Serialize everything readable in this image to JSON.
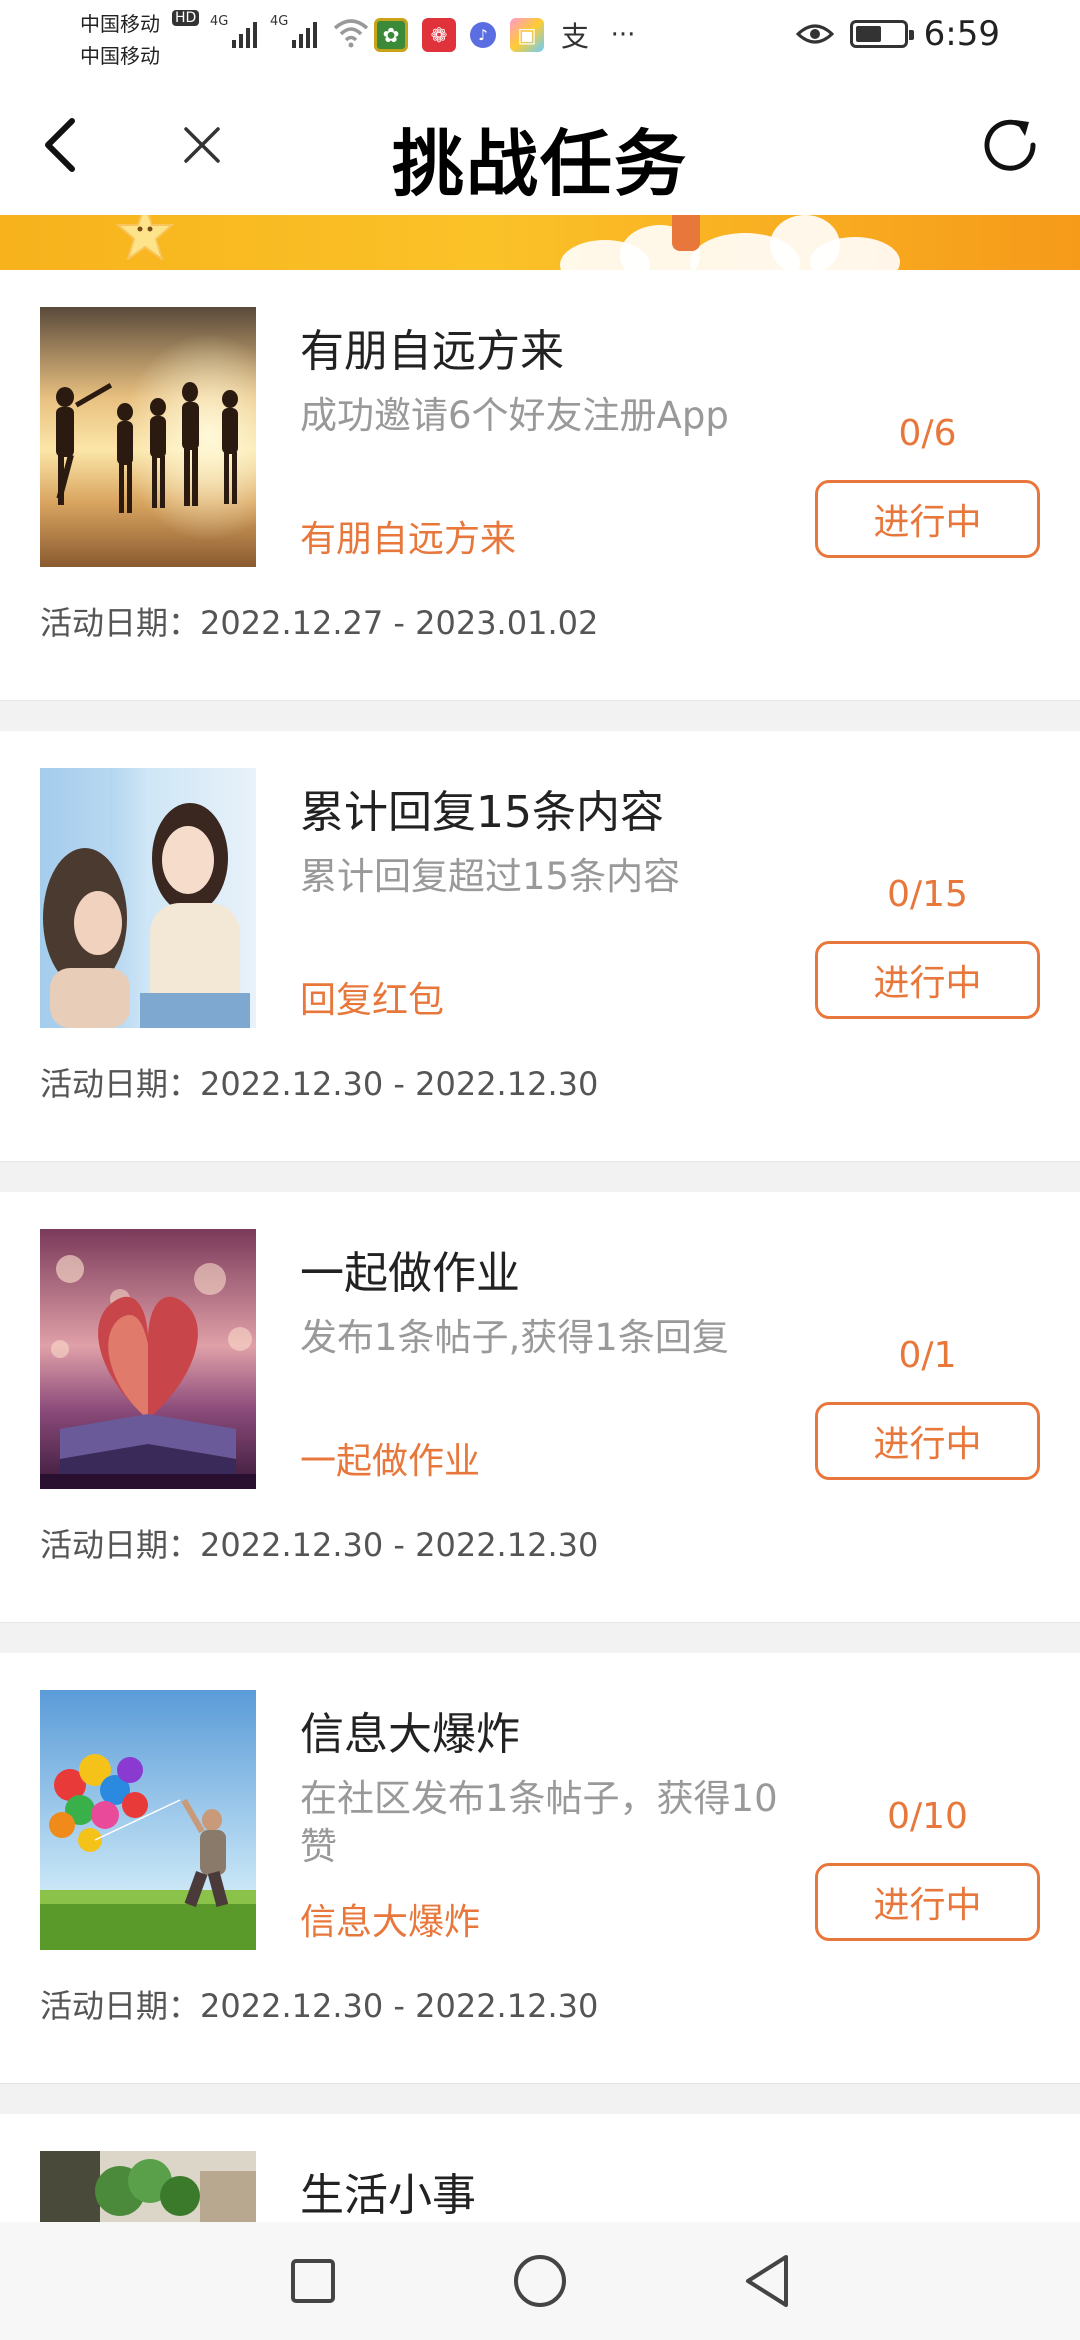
{
  "status_bar": {
    "carrier_1": "中国移动",
    "carrier_2": "中国移动",
    "hd": "HD",
    "network_1": "4G",
    "network_2": "4G",
    "battery_level": 0.55,
    "time": "6:59",
    "app_icons": [
      "app-badge-icon",
      "pinduoduo-icon",
      "music-icon",
      "gallery-icon",
      "alipay-icon"
    ],
    "more": "···"
  },
  "header": {
    "title": "挑战任务",
    "back_icon": "chevron-left-icon",
    "close_icon": "close-icon",
    "refresh_icon": "refresh-icon"
  },
  "tasks": [
    {
      "title": "有朋自远方来",
      "description": "成功邀请6个好友注册App",
      "tag": "有朋自远方来",
      "progress": "0/6",
      "status": "进行中",
      "date": "活动日期：2022.12.27 - 2023.01.02",
      "thumb": "beach-friends-image"
    },
    {
      "title": "累计回复15条内容",
      "description": "累计回复超过15条内容",
      "tag": "回复红包",
      "progress": "0/15",
      "status": "进行中",
      "date": "活动日期：2022.12.30 - 2022.12.30",
      "thumb": "two-girls-image"
    },
    {
      "title": "一起做作业",
      "description": "发布1条帖子,获得1条回复",
      "tag": "一起做作业",
      "progress": "0/1",
      "status": "进行中",
      "date": "活动日期：2022.12.30 - 2022.12.30",
      "thumb": "heart-book-image"
    },
    {
      "title": "信息大爆炸",
      "description": "在社区发布1条帖子，获得10赞",
      "tag": "信息大爆炸",
      "progress": "0/10",
      "status": "进行中",
      "date": "活动日期：2022.12.30 - 2022.12.30",
      "thumb": "balloons-image"
    },
    {
      "title": "生活小事",
      "thumb": "plants-image"
    }
  ],
  "nav": {
    "recent_icon": "square-icon",
    "home_icon": "circle-icon",
    "back_icon": "triangle-back-icon"
  },
  "colors": {
    "accent": "#e8773c",
    "banner_start": "#f7b21c",
    "banner_end": "#f69a1a"
  }
}
